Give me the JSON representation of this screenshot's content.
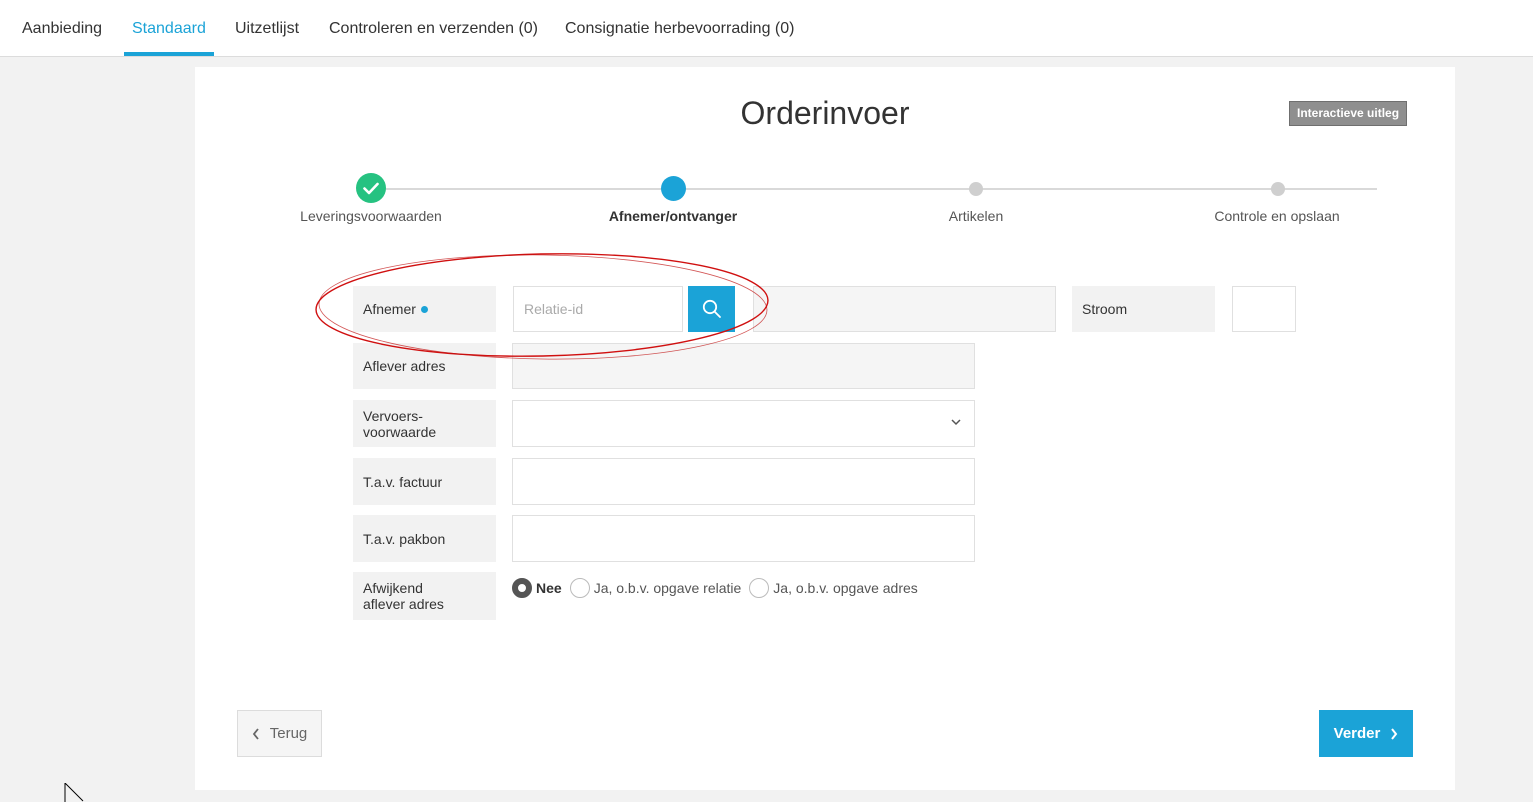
{
  "tabs": [
    {
      "label": "Aanbieding",
      "active": false
    },
    {
      "label": "Standaard",
      "active": true
    },
    {
      "label": "Uitzetlijst",
      "active": false
    },
    {
      "label": "Controleren en verzenden (0)",
      "active": false
    },
    {
      "label": "Consignatie herbevoorrading (0)",
      "active": false
    }
  ],
  "page": {
    "title": "Orderinvoer",
    "help_button": "Interactieve uitleg"
  },
  "stepper": {
    "steps": [
      {
        "label": "Leveringsvoorwaarden",
        "state": "done"
      },
      {
        "label": "Afnemer/ontvanger",
        "state": "current"
      },
      {
        "label": "Artikelen",
        "state": "todo"
      },
      {
        "label": "Controle en opslaan",
        "state": "todo"
      }
    ]
  },
  "form": {
    "afnemer_label": "Afnemer",
    "relatie_placeholder": "Relatie-id",
    "relatie_value": "",
    "stroom_label": "Stroom",
    "aflever_adres_label": "Aflever adres",
    "vervoers_label_1": "Vervoers-",
    "vervoers_label_2": "voorwaarde",
    "tav_factuur_label": "T.a.v. factuur",
    "tav_pakbon_label": "T.a.v. pakbon",
    "afwijkend_label_1": "Afwijkend",
    "afwijkend_label_2": "aflever adres",
    "radio_options": [
      "Nee",
      "Ja, o.b.v. opgave relatie",
      "Ja, o.b.v. opgave adres"
    ],
    "radio_selected": "Nee"
  },
  "nav": {
    "back_label": "Terug",
    "next_label": "Verder"
  },
  "colors": {
    "accent": "#1ba3d7",
    "done": "#26c281",
    "annotation": "#d01010"
  }
}
